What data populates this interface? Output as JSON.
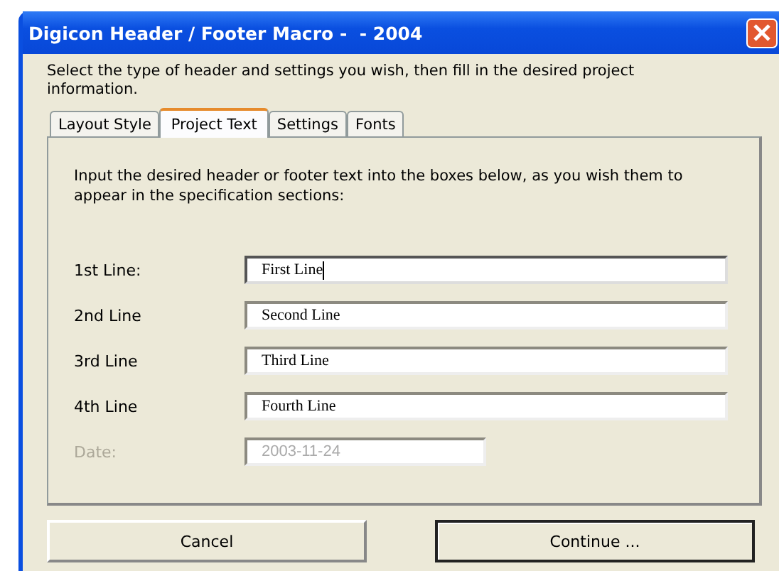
{
  "window": {
    "title": "Digicon Header / Footer Macro -  - 2004"
  },
  "intro": "Select the type of header and settings you wish, then fill in the desired project information.",
  "tabs": [
    {
      "label": "Layout Style",
      "selected": false
    },
    {
      "label": "Project Text",
      "selected": true
    },
    {
      "label": "Settings",
      "selected": false
    },
    {
      "label": "Fonts",
      "selected": false
    }
  ],
  "panel": {
    "instructions": "Input the desired header or footer text into the boxes below, as you wish them to appear in the specification sections:",
    "fields": [
      {
        "label": "1st Line:",
        "value": "First Line",
        "disabled": false,
        "focused": true
      },
      {
        "label": "2nd Line",
        "value": "Second Line",
        "disabled": false,
        "focused": false
      },
      {
        "label": "3rd Line",
        "value": "Third Line",
        "disabled": false,
        "focused": false
      },
      {
        "label": "4th Line",
        "value": "Fourth Line",
        "disabled": false,
        "focused": false
      },
      {
        "label": "Date:",
        "value": "2003-11-24",
        "disabled": true,
        "focused": false
      }
    ]
  },
  "buttons": [
    {
      "label": "Cancel",
      "default": false
    },
    {
      "label": "Continue ...",
      "default": true
    }
  ]
}
